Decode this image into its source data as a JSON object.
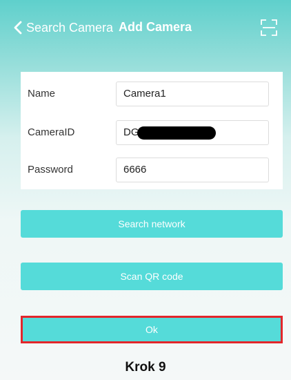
{
  "nav": {
    "back_label": "Search Camera",
    "title": "Add Camera",
    "back_icon": "chevron-left-icon",
    "scan_icon": "scan-frame-icon"
  },
  "form": {
    "name": {
      "label": "Name",
      "value": "Camera1"
    },
    "camera_id": {
      "label": "CameraID",
      "value": "DG"
    },
    "password": {
      "label": "Password",
      "value": "6666"
    }
  },
  "buttons": {
    "search_network": "Search network",
    "scan_qr": "Scan QR code",
    "ok": "Ok"
  },
  "caption": "Krok 9",
  "colors": {
    "accent": "#55dbd9",
    "highlight": "#e3262b",
    "header": "#5fd0cc"
  }
}
